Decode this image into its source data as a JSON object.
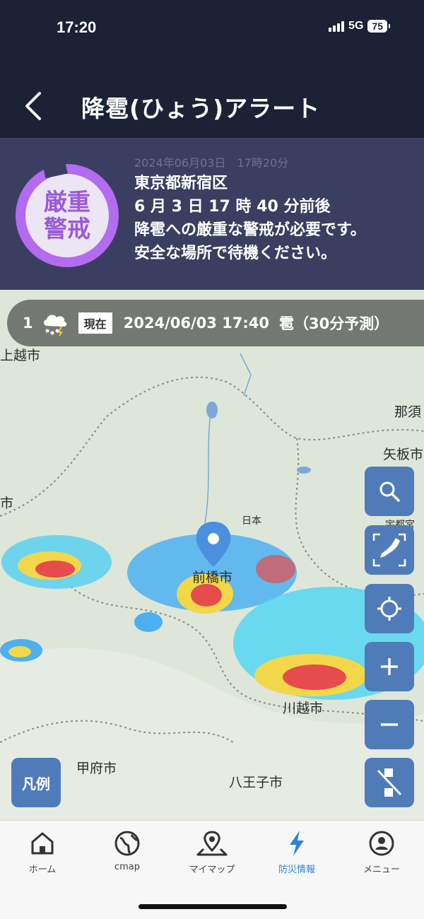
{
  "status_bar": {
    "time": "17:20",
    "network": "5G",
    "battery": "75"
  },
  "header": {
    "title": "降雹(ひょう)アラート"
  },
  "alert": {
    "level_line1": "厳重",
    "level_line2": "警戒",
    "datetime": "2024年06月03日　17時20分",
    "area": "東京都新宿区",
    "time": "6 月 3 日 17 時 40 分前後",
    "message_line1": "降雹への厳重な警戒が必要です。",
    "message_line2": "安全な場所で待機ください。"
  },
  "timebar": {
    "number": "1",
    "now_badge": "現在",
    "datetime": "2024/06/03 17:40",
    "type": "雹（30分予測）"
  },
  "map": {
    "places": [
      "上越市",
      "那須",
      "矢板市",
      "市",
      "日本",
      "宇都宮市",
      "前橋市",
      "川越市",
      "甲府市",
      "八王子市"
    ],
    "legend_button": "凡例"
  },
  "nav": {
    "items": [
      {
        "label": "ホーム",
        "icon": "home-icon"
      },
      {
        "label": "cmap",
        "icon": "globe-icon"
      },
      {
        "label": "マイマップ",
        "icon": "map-pin-icon"
      },
      {
        "label": "防災情報",
        "icon": "lightning-icon"
      },
      {
        "label": "メニュー",
        "icon": "user-icon"
      }
    ],
    "active_index": 3
  },
  "colors": {
    "header_bg": "#1b2236",
    "alert_bg": "#3a3f61",
    "alert_ring": "#b36bf0",
    "map_button": "#4f7cb8",
    "active_nav": "#2c86d6"
  }
}
